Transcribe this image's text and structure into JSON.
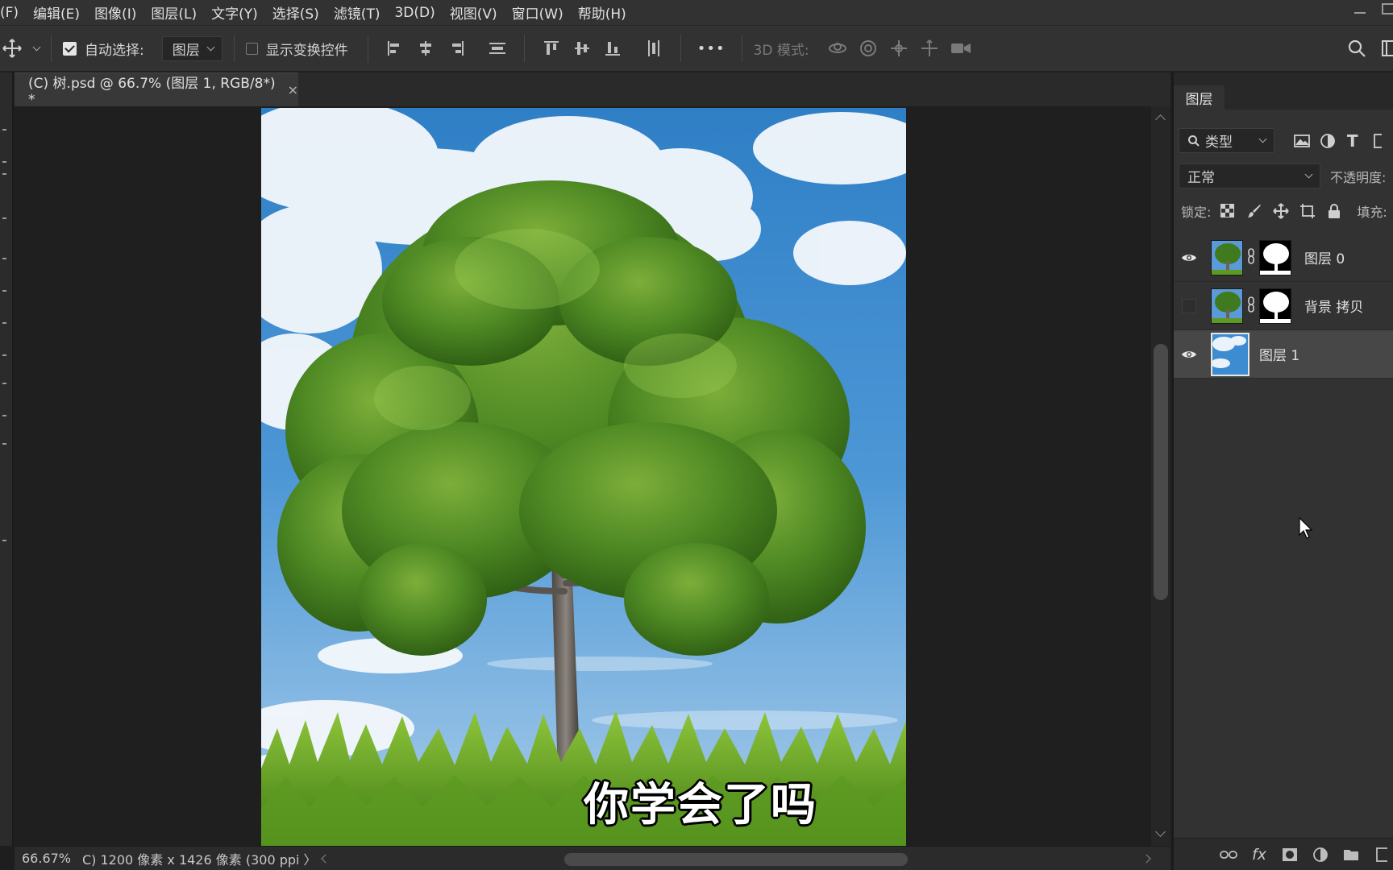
{
  "menubar": {
    "items": [
      "(F)",
      "编辑(E)",
      "图像(I)",
      "图层(L)",
      "文字(Y)",
      "选择(S)",
      "滤镜(T)",
      "3D(D)",
      "视图(V)",
      "窗口(W)",
      "帮助(H)"
    ]
  },
  "options": {
    "auto_select_label": "自动选择:",
    "auto_select_checked": true,
    "auto_select_target": "图层",
    "show_transform_label": "显示变换控件",
    "more_label": "•••",
    "mode_3d_label": "3D 模式:"
  },
  "document": {
    "tab_title": "(C) 树.psd @ 66.7% (图层 1, RGB/8*) *",
    "close_symbol": "×",
    "caption": "你学会了吗"
  },
  "status": {
    "zoom": "66.67%",
    "info": "C) 1200 像素 x 1426 像素 (300 ppi 〉"
  },
  "layers_panel": {
    "tab_label": "图层",
    "filter_kind": "类型",
    "blend_mode": "正常",
    "opacity_label": "不透明度:",
    "lock_label": "锁定:",
    "fill_label": "填充:",
    "layers": [
      {
        "name": "图层 0",
        "visible": true,
        "has_mask": true,
        "selected": false
      },
      {
        "name": "背景 拷贝",
        "visible": false,
        "has_mask": true,
        "selected": false
      },
      {
        "name": "图层 1",
        "visible": true,
        "has_mask": false,
        "selected": true
      }
    ]
  },
  "icons": {
    "move_tool": "move-icon",
    "search": "search-icon",
    "eye": "eye-icon"
  }
}
